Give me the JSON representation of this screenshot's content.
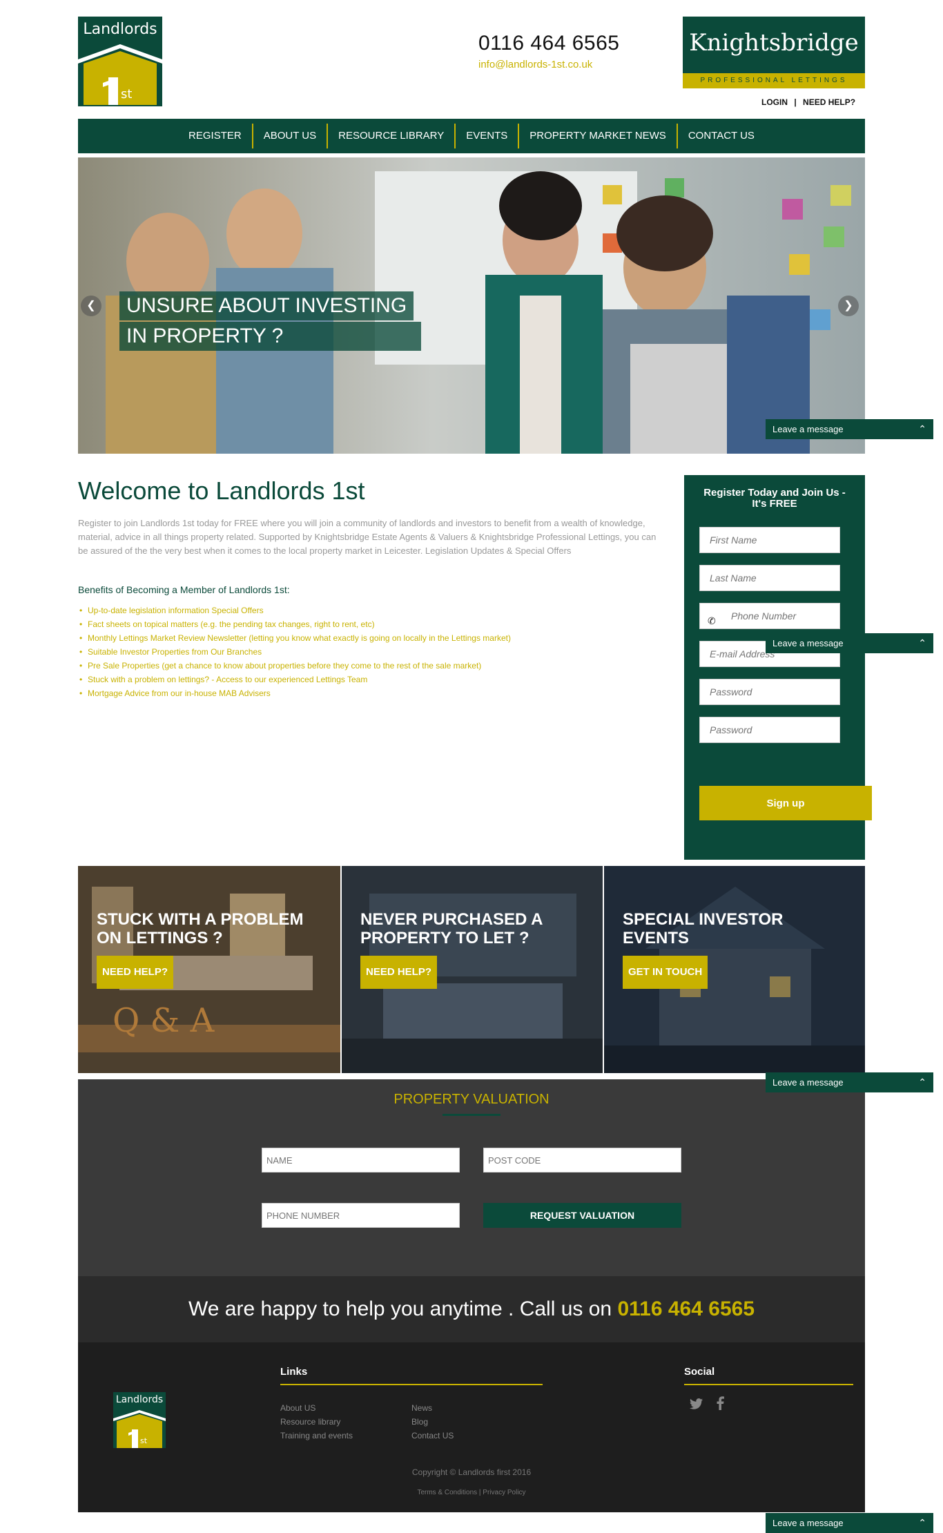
{
  "header": {
    "logo_text": "Landlords",
    "logo_mark": "st",
    "phone": "0116 464 6565",
    "email": "info@landlords-1st.co.uk",
    "partner_name": "Knightsbridge",
    "partner_tagline": "PROFESSIONAL LETTINGS",
    "login_label": "LOGIN",
    "separator": "|",
    "help_label": "NEED HELP?"
  },
  "nav": {
    "items": [
      "REGISTER",
      "ABOUT US",
      "RESOURCE LIBRARY",
      "EVENTS",
      "PROPERTY MARKET NEWS",
      "CONTACT US"
    ]
  },
  "hero": {
    "caption_line1": "UNSURE ABOUT INVESTING",
    "caption_line2": "IN PROPERTY ?",
    "prev_icon": "chevron-left-icon",
    "next_icon": "chevron-right-icon"
  },
  "leave_message": {
    "label": "Leave a message",
    "icon": "chevron-up-icon"
  },
  "welcome": {
    "title": "Welcome to Landlords 1st",
    "text": "Register to join Landlords 1st today for FREE where you will join a community of landlords and investors to benefit from a wealth of knowledge, material, advice in all things property related. Supported by Knightsbridge Estate Agents & Valuers & Knightsbridge Professional Lettings, you can be assured of the the very best when it comes to the local property market in Leicester. Legislation Updates & Special Offers",
    "benefits_title": "Benefits of Becoming a Member of Landlords 1st:",
    "benefits": [
      "Up-to-date legislation information Special Offers",
      "Fact sheets on topical matters (e.g. the pending tax changes, right to rent, etc)",
      "Monthly Lettings Market Review Newsletter (letting you know what exactly is going on locally in the Lettings market)",
      "Suitable Investor Properties from Our Branches",
      "Pre Sale Properties (get a chance to know about properties before they come to the rest of the sale market)",
      "Stuck with a problem on lettings? - Access to our experienced Lettings Team",
      "Mortgage Advice from our in-house MAB Advisers"
    ]
  },
  "register": {
    "title": "Register Today and Join Us - It's FREE",
    "first_name_placeholder": "First Name",
    "last_name_placeholder": "Last Name",
    "phone_placeholder": "Phone Number",
    "email_placeholder": "E-mail Address",
    "password_placeholder": "Password",
    "password_confirm_placeholder": "Password",
    "signup_label": "Sign up"
  },
  "tiles": [
    {
      "title": "STUCK WITH A PROBLEM ON LETTINGS ?",
      "button": "NEED HELP?"
    },
    {
      "title": "NEVER PURCHASED A PROPERTY TO LET ?",
      "button": "NEED HELP?"
    },
    {
      "title": "SPECIAL INVESTOR EVENTS",
      "button": "GET IN TOUCH"
    }
  ],
  "valuation": {
    "title": "PROPERTY VALUATION",
    "name_placeholder": "NAME",
    "postcode_placeholder": "POST CODE",
    "phone_placeholder": "PHONE NUMBER",
    "button_label": "REQUEST VALUATION"
  },
  "callband": {
    "text": "We are happy to help you anytime . Call us on ",
    "number": "0116 464 6565"
  },
  "footer": {
    "logo_text": "Landlords",
    "logo_mark": "st",
    "links_title": "Links",
    "links_col1": [
      "About US",
      "Resource library",
      "Training and events"
    ],
    "links_col2": [
      "News",
      "Blog",
      "Contact US"
    ],
    "social_title": "Social",
    "social_icons": [
      "twitter-icon",
      "facebook-icon"
    ],
    "copyright": "Copyright © Landlords first 2016",
    "legal": "Terms & Conditions | Privacy Policy"
  },
  "colors": {
    "brand_green": "#0b4a3a",
    "brand_gold": "#c8b200"
  }
}
